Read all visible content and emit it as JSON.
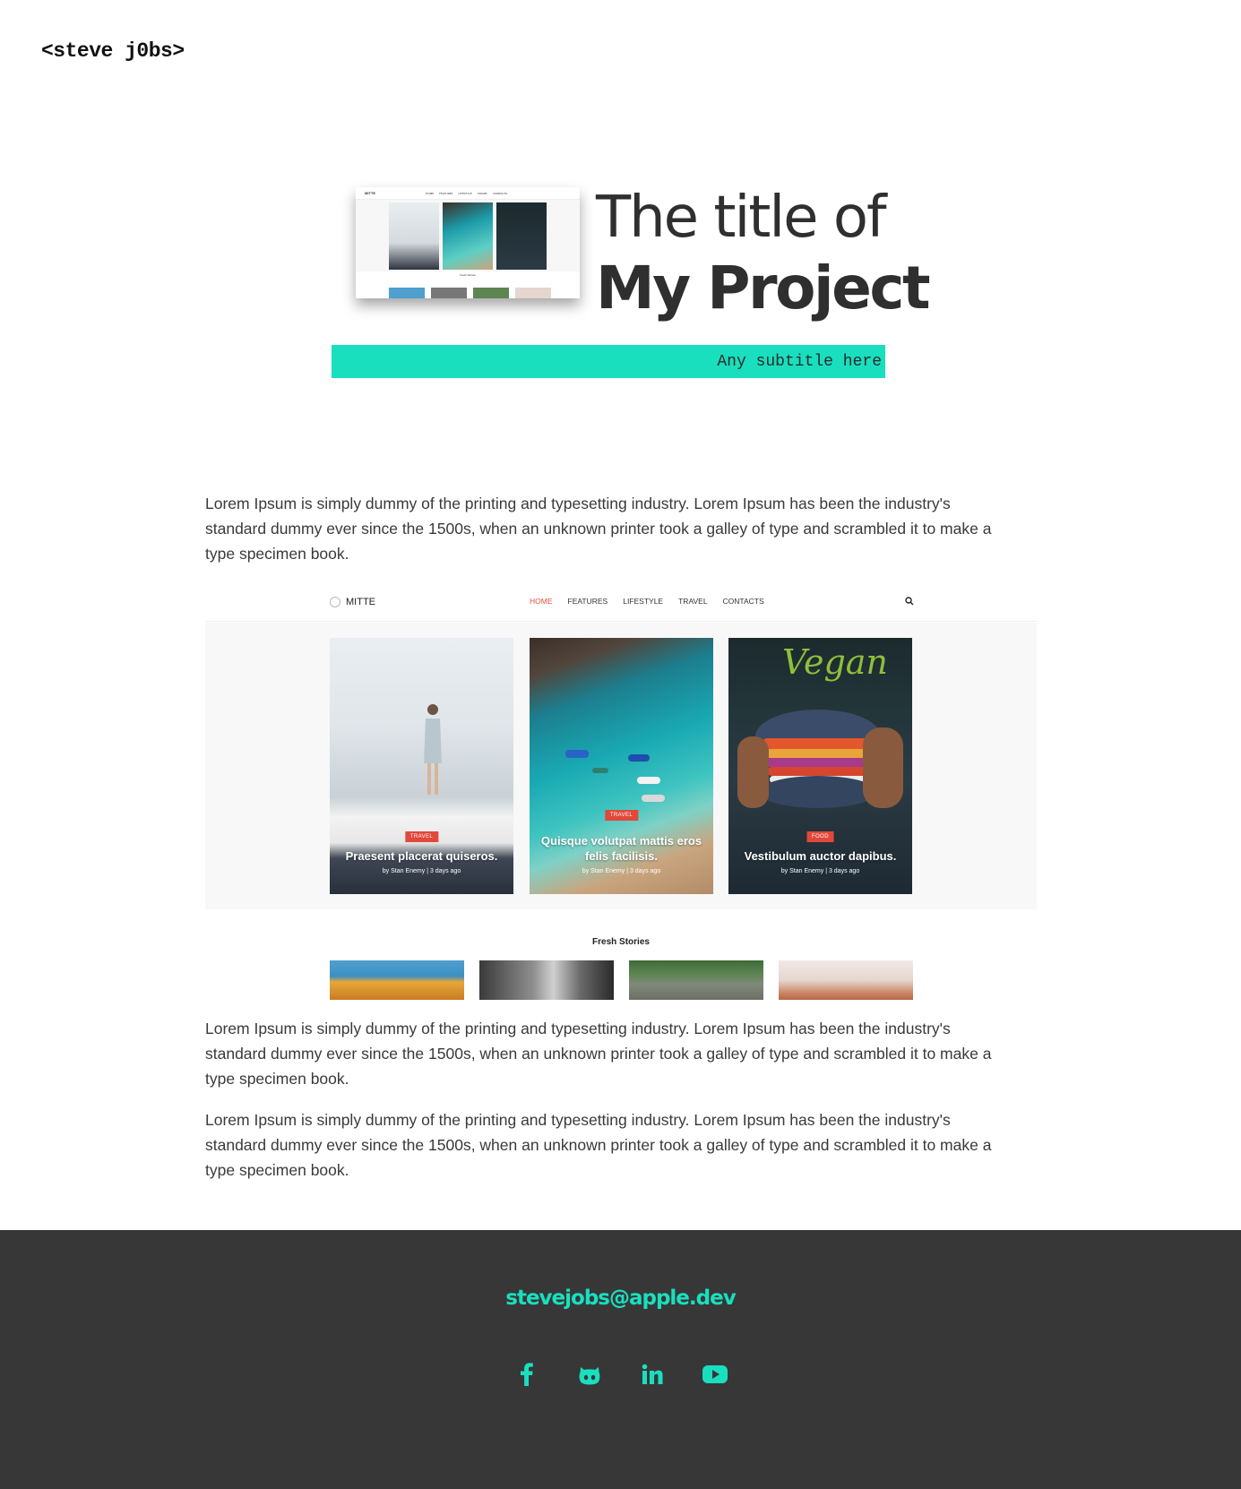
{
  "site": {
    "logo": "<steve j0bs>"
  },
  "hero": {
    "title_line1": "The title of",
    "title_line2": "My Project",
    "subtitle": "Any subtitle here",
    "accent_color": "#19dfbf"
  },
  "content": {
    "paragraphs": [
      "Lorem Ipsum is simply dummy of the printing and typesetting industry. Lorem Ipsum has been the industry's standard dummy ever since the 1500s, when an unknown printer took a galley of type and scrambled it to make a type specimen book.",
      "Lorem Ipsum is simply dummy of the printing and typesetting industry. Lorem Ipsum has been the industry's standard dummy ever since the 1500s, when an unknown printer took a galley of type and scrambled it to make a type specimen book.",
      "Lorem Ipsum is simply dummy of the printing and typesetting industry. Lorem Ipsum has been the industry's standard dummy ever since the 1500s, when an unknown printer took a galley of type and scrambled it to make a type specimen book."
    ]
  },
  "screenshot": {
    "brand": "MITTE",
    "menu": [
      "HOME",
      "FEATURES",
      "LIFESTYLE",
      "TRAVEL",
      "CONTACTS"
    ],
    "menu_active": "HOME",
    "cards": [
      {
        "badge": "TRAVEL",
        "title": "Praesent placerat quiseros.",
        "meta": "by Stan Enemy  |  3 days ago"
      },
      {
        "badge": "TRAVEL",
        "title": "Quisque volutpat mattis eros felis facilisis.",
        "meta": "by Stan Enemy  |  3 days ago"
      },
      {
        "badge": "FOOD",
        "title": "Vestibulum auctor dapibus.",
        "meta": "by Stan Enemy  |  3 days ago"
      }
    ],
    "fresh_title": "Fresh Stories",
    "badge_color": "#e2483a"
  },
  "footer": {
    "email": "stevejobs@apple.dev",
    "socials": [
      "facebook-icon",
      "github-icon",
      "linkedin-icon",
      "youtube-icon"
    ],
    "background": "#373737"
  }
}
